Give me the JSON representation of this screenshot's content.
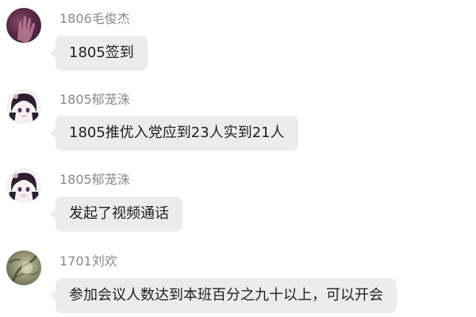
{
  "messages": [
    {
      "sender": "1806毛俊杰",
      "text": "1805签到",
      "avatar_icon": "user-avatar-hand-icon"
    },
    {
      "sender": "1805郁茏洙",
      "text": "1805推优入党应到23人实到21人",
      "avatar_icon": "user-avatar-anime-girl-icon"
    },
    {
      "sender": "1805郁茏洙",
      "text": "发起了视频通话",
      "avatar_icon": "user-avatar-anime-girl-icon"
    },
    {
      "sender": "1701刘欢",
      "text": "参加会议人数达到本班百分之九十以上，可以开会",
      "avatar_icon": "user-avatar-ink-painting-icon"
    }
  ],
  "colors": {
    "bubble_bg": "#ececec",
    "sender_text": "#8a8a8a",
    "message_text": "#1f1f1f"
  }
}
